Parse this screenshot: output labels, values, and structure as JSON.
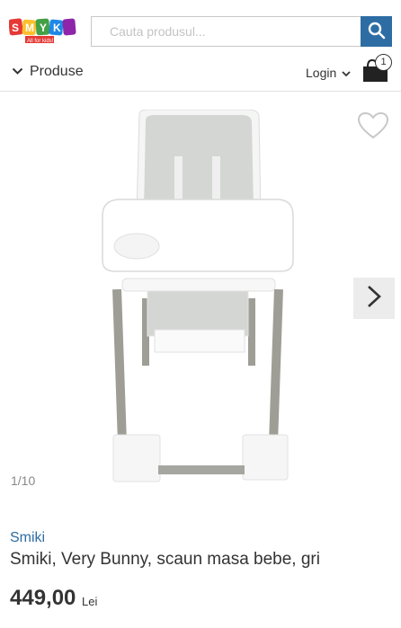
{
  "header": {
    "logo_text": "Smyk",
    "logo_tagline": "All for kids!",
    "search_placeholder": "Cauta produsul..."
  },
  "nav": {
    "products_label": "Produse",
    "login_label": "Login",
    "cart_count": "1"
  },
  "gallery": {
    "counter": "1/10"
  },
  "product": {
    "brand": "Smiki",
    "title": "Smiki, Very Bunny, scaun masa bebe, gri",
    "price": "449,00",
    "currency": "Lei"
  },
  "colors": {
    "accent_blue": "#2e6da4",
    "text": "#333333"
  }
}
